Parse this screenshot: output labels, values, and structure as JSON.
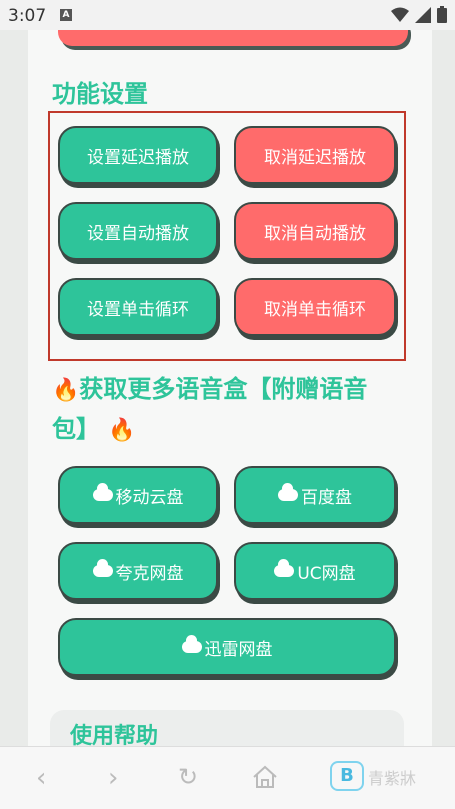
{
  "status_bar": {
    "time": "3:07"
  },
  "settings": {
    "title": "功能设置",
    "buttons": [
      {
        "label": "设置延迟播放",
        "color": "#2ec49a"
      },
      {
        "label": "取消延迟播放",
        "color": "#ff6b6b"
      },
      {
        "label": "设置自动播放",
        "color": "#2ec49a"
      },
      {
        "label": "取消自动播放",
        "color": "#ff6b6b"
      },
      {
        "label": "设置单击循环",
        "color": "#2ec49a"
      },
      {
        "label": "取消单击循环",
        "color": "#ff6b6b"
      }
    ]
  },
  "promo": {
    "fire_icon": "🔥",
    "text_line1": "获取更多语音盒【附赠语音",
    "text_line2": "包】"
  },
  "cloud_buttons": [
    {
      "label": "移动云盘"
    },
    {
      "label": "百度盘"
    },
    {
      "label": "夸克网盘"
    },
    {
      "label": "UC网盘"
    },
    {
      "label": "迅雷网盘"
    }
  ],
  "help": {
    "title": "使用帮助"
  },
  "nav": {
    "logo_letter": "B",
    "logo_text": "青紫牀"
  },
  "colors": {
    "accent": "#2ec49a",
    "danger": "#ff6b6b",
    "frame": "#c0392b"
  }
}
